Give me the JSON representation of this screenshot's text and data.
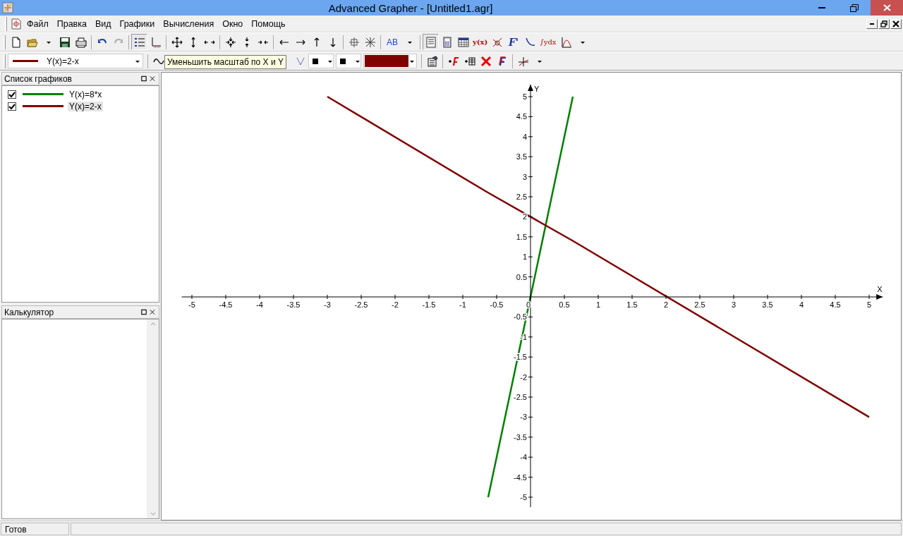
{
  "window": {
    "title": "Advanced Grapher - [Untitled1.agr]"
  },
  "menu": [
    "Файл",
    "Правка",
    "Вид",
    "Графики",
    "Вычисления",
    "Окно",
    "Помощь"
  ],
  "toolbar": {
    "labels": [
      "AB",
      "y(x)",
      "F'",
      "∫ydx"
    ],
    "graph_list_on": true
  },
  "toolbar2": {
    "current_graph": {
      "label": "Y(x)=2-x",
      "color": "#800000"
    },
    "tooltip": "Уменьшить масштаб по X и Y"
  },
  "graph_list": {
    "title": "Список графиков",
    "items": [
      {
        "label": "Y(x)=8*x",
        "checked": true,
        "selected": false,
        "color": "#008000"
      },
      {
        "label": "Y(x)=2-x",
        "checked": true,
        "selected": true,
        "color": "#800000"
      }
    ]
  },
  "calculator": {
    "title": "Калькулятор"
  },
  "chart_data": {
    "type": "line",
    "xlabel": "X",
    "ylabel": "Y",
    "x": [
      -3,
      -0.625,
      0,
      0.625,
      5
    ],
    "series": [
      {
        "color": "#008000",
        "values": [
          null,
          -5,
          0,
          5,
          null
        ]
      },
      {
        "color": "#800000",
        "values": [
          5,
          2.6,
          2,
          1.4,
          -3
        ]
      }
    ],
    "xlim": [
      -5.15,
      5.2
    ],
    "ylim": [
      -5.25,
      5.3
    ],
    "xticks": [
      -5,
      -4.5,
      -4,
      -3.5,
      -3,
      -2.5,
      -2,
      -1.5,
      -1,
      -0.5,
      0,
      0.5,
      1,
      1.5,
      2,
      2.5,
      3,
      3.5,
      4,
      4.5,
      5
    ],
    "yticks": [
      -5,
      -4.5,
      -4,
      -3.5,
      -3,
      -2.5,
      -2,
      -1.5,
      -1,
      -0.5,
      0.5,
      1,
      1.5,
      2,
      2.5,
      3,
      3.5,
      4,
      4.5,
      5
    ]
  },
  "status_bar": {
    "text": "Готов"
  }
}
